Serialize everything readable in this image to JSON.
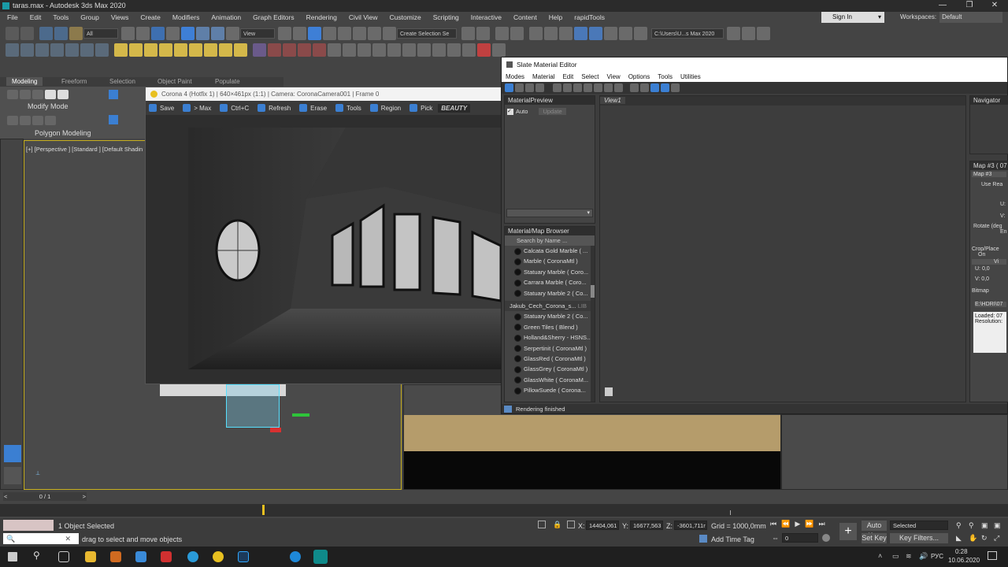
{
  "window": {
    "title": "taras.max - Autodesk 3ds Max 2020"
  },
  "menu": [
    "File",
    "Edit",
    "Tools",
    "Group",
    "Views",
    "Create",
    "Modifiers",
    "Animation",
    "Graph Editors",
    "Rendering",
    "Civil View",
    "Customize",
    "Scripting",
    "Interactive",
    "Content",
    "Help",
    "rapidTools"
  ],
  "signin": {
    "label": "Sign In"
  },
  "workspaces": {
    "label": "Workspaces:",
    "value": "Default"
  },
  "toolbar": {
    "filter_value": "All",
    "view_value": "View",
    "selection_set_placeholder": "Create Selection Se",
    "project_path": "C:\\Users\\U...s Max 2020"
  },
  "ribbon": {
    "tabs": [
      "Modeling",
      "Freeform",
      "Selection",
      "Object Paint",
      "Populate"
    ],
    "modify_mode": "Modify Mode",
    "polygon_modeling": "Polygon Modeling"
  },
  "viewport": {
    "label": "[+] [Perspective ] [Standard ] [Default Shadin"
  },
  "corona": {
    "title": "Corona 4 (Hotfix 1) | 640×461px (1:1) | Camera: CoronaCamera001 | Frame 0",
    "buttons": [
      "Save",
      "> Max",
      "Ctrl+C",
      "Refresh",
      "Erase",
      "Tools",
      "Region",
      "Pick"
    ],
    "pass": "BEAUTY"
  },
  "slate": {
    "title": "Slate Material Editor",
    "menu": [
      "Modes",
      "Material",
      "Edit",
      "Select",
      "View",
      "Options",
      "Tools",
      "Utilities"
    ],
    "preview_title": "MaterialPreview",
    "auto_label": "Auto",
    "update_label": "Update",
    "browser_title": "Material/Map Browser",
    "search_placeholder": "Search by Name ...",
    "items_top": [
      "Calcata Gold Marble ( ...",
      "Marble  ( CoronaMtl )",
      "Statuary Marble  ( Coro...",
      "Carrara Marble  ( Coro...",
      "Statuary Marble 2  ( Co..."
    ],
    "group2": "Jakub_Cech_Corona_s...",
    "group2_tag": "LIB",
    "items_bottom": [
      "Statuary Marble 2  ( Co...",
      "Green Tiles  ( Blend )",
      "Holland&Sherry - HSNS...",
      "Serpertinit  ( CoronaMtl )",
      "GlassRed  ( CoronaMtl )",
      "GlassGrey  ( CoronaMtl )",
      "GlassWhite  ( CoronaM...",
      "PillowSuede  ( Corona..."
    ],
    "view_tab": "View1",
    "navigator": "Navigator",
    "status": "Rendering finished",
    "map_title": "Map #3  ( 07",
    "map_name": "Map #3",
    "use_real": "Use Rea",
    "u_label": "U:",
    "v_label": "V:",
    "rotate": "Rotate (deg",
    "rotate2": "En",
    "crop_title": "Crop/Place",
    "on_label": "On",
    "vi_label": "Vi",
    "u_val": "U: 0,0",
    "v_val": "V: 0,0",
    "bitmap_title": "Bitmap",
    "bitmap_path": "E:\\HDRI\\07",
    "loaded": "Loaded: 07",
    "resolution": "Resolution:"
  },
  "timeline": {
    "frame": "0 / 1"
  },
  "status": {
    "selected": "1 Object Selected",
    "hint": "drag to select and move objects",
    "x_label": "X:",
    "x": "14404,061",
    "y_label": "Y:",
    "y": "16677,563",
    "z_label": "Z:",
    "z": "-3601,711r",
    "grid": "Grid = 1000,0mm",
    "add_time_tag": "Add Time Tag",
    "auto_key": "Auto Key",
    "set_key": "Set Key",
    "selected_drop": "Selected",
    "key_filters": "Key Filters...",
    "frame_value": "0"
  },
  "taskbar": {
    "lang": "РУС",
    "time": "0:28",
    "date": "10.06.2020"
  },
  "colors": {
    "accent": "#3b7fd2",
    "floor": "#b59c6b"
  }
}
